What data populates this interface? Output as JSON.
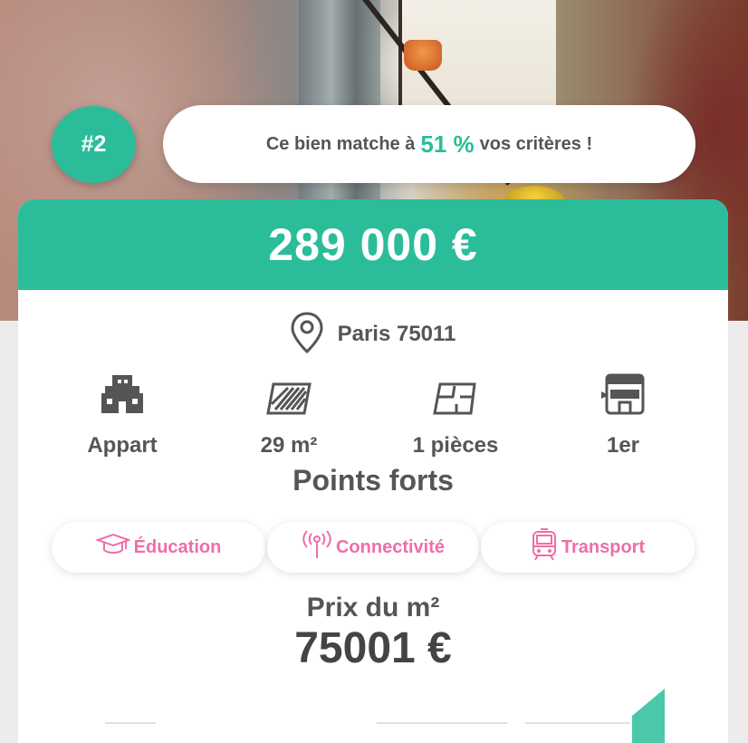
{
  "listing": {
    "rank": "#2",
    "match": {
      "prefix": "Ce bien matche à",
      "percent": "51 %",
      "suffix": "vos critères !"
    },
    "price": "289 000 €",
    "location": "Paris 75011",
    "features": [
      {
        "icon": "building-icon",
        "value": "Appart"
      },
      {
        "icon": "surface-icon",
        "value": "29 m²"
      },
      {
        "icon": "floorplan-icon",
        "value": "1 pièces"
      },
      {
        "icon": "floor-level-icon",
        "value": "1er"
      }
    ],
    "strengths_title": "Points forts",
    "strengths": [
      {
        "icon": "graduation-cap-icon",
        "label": "Éducation"
      },
      {
        "icon": "antenna-icon",
        "label": "Connectivité"
      },
      {
        "icon": "tram-icon",
        "label": "Transport"
      }
    ],
    "price_per_m2": {
      "label": "Prix du m²",
      "value": "75001 €"
    }
  },
  "colors": {
    "accent": "#2bbd9a",
    "highlight_pink": "#ee6ea8",
    "text_dark": "#555555",
    "background": "#ececec"
  }
}
